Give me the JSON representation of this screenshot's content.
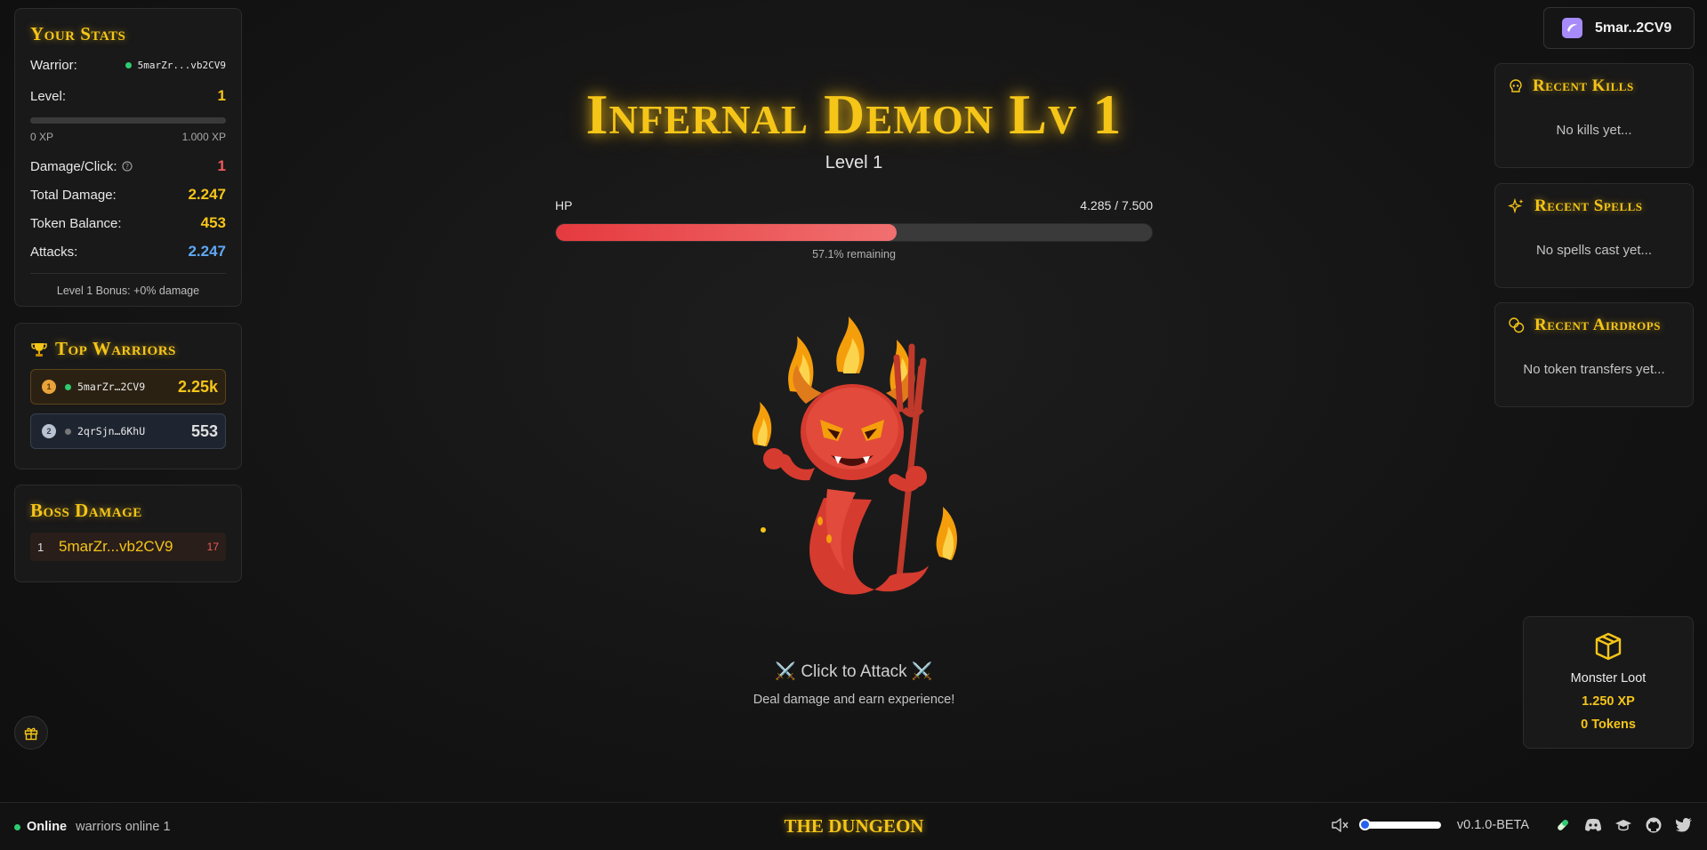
{
  "stats": {
    "title": "Your Stats",
    "warrior_label": "Warrior:",
    "warrior_value": "5marZr...vb2CV9",
    "level_label": "Level:",
    "level_value": "1",
    "xp_progress": 0,
    "xp_min": "0 XP",
    "xp_max": "1.000 XP",
    "damage_label": "Damage/Click:",
    "damage_value": "1",
    "total_damage_label": "Total Damage:",
    "total_damage_value": "2.247",
    "token_balance_label": "Token Balance:",
    "token_balance_value": "453",
    "attacks_label": "Attacks:",
    "attacks_value": "2.247",
    "bonus": "Level 1 Bonus: +0% damage"
  },
  "top_warriors": {
    "title": "Top Warriors",
    "items": [
      {
        "rank": "1",
        "name": "5marZr…2CV9",
        "score": "2.25k",
        "online": true
      },
      {
        "rank": "2",
        "name": "2qrSjn…6KhU",
        "score": "553",
        "online": false
      }
    ]
  },
  "boss_damage": {
    "title": "Boss Damage",
    "items": [
      {
        "rank": "1",
        "name": "5marZr...vb2CV9",
        "value": "17"
      }
    ]
  },
  "boss": {
    "title": "Infernal Demon Lv 1",
    "level": "Level 1",
    "hp_label": "HP",
    "hp_value": "4.285 / 7.500",
    "hp_fraction": 0.571,
    "hp_remaining": "57.1% remaining",
    "attack_text": "⚔️ Click to Attack ⚔️",
    "attack_sub": "Deal damage and earn experience!"
  },
  "wallet": {
    "label": "5mar..2CV9"
  },
  "recent_kills": {
    "title": "Recent Kills",
    "empty": "No kills yet..."
  },
  "recent_spells": {
    "title": "Recent Spells",
    "empty": "No spells cast yet..."
  },
  "recent_airdrops": {
    "title": "Recent Airdrops",
    "empty": "No token transfers yet..."
  },
  "loot": {
    "title": "Monster Loot",
    "xp": "1.250 XP",
    "tokens": "0 Tokens"
  },
  "footer": {
    "status": "Online",
    "warriors_online": "warriors online 1",
    "brand": "THE DUNGEON",
    "version": "v0.1.0-BETA",
    "volume_level": 0
  },
  "colors": {
    "gold": "#f5c518",
    "red": "#f05a5a",
    "blue": "#5fa8f5",
    "online_green": "#2ecc71",
    "hp_fill": "#e53a3f"
  }
}
